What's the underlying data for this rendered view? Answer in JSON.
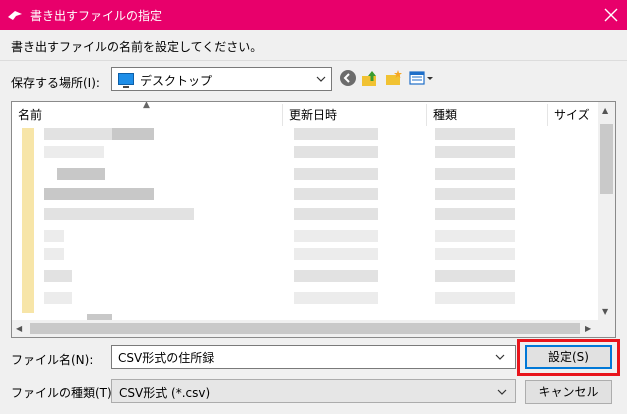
{
  "window": {
    "title": "書き出すファイルの指定"
  },
  "instruction": "書き出すファイルの名前を設定してください。",
  "save_in": {
    "label": "保存する場所(I):",
    "value": "デスクトップ"
  },
  "toolbar": {
    "icons": [
      "back-icon",
      "up-folder-icon",
      "new-folder-icon",
      "view-menu-icon"
    ]
  },
  "columns": [
    {
      "label": "名前"
    },
    {
      "label": "更新日時"
    },
    {
      "label": "種類"
    },
    {
      "label": "サイズ"
    }
  ],
  "file_name": {
    "label": "ファイル名(N):",
    "value": "CSV形式の住所録"
  },
  "file_type": {
    "label": "ファイルの種類(T):",
    "value": "CSV形式 (*.csv)"
  },
  "buttons": {
    "save": "設定(S)",
    "cancel": "キャンセル"
  },
  "colors": {
    "titlebar": "#e8006b",
    "highlight": "#e8141b",
    "accent": "#0078d7"
  }
}
